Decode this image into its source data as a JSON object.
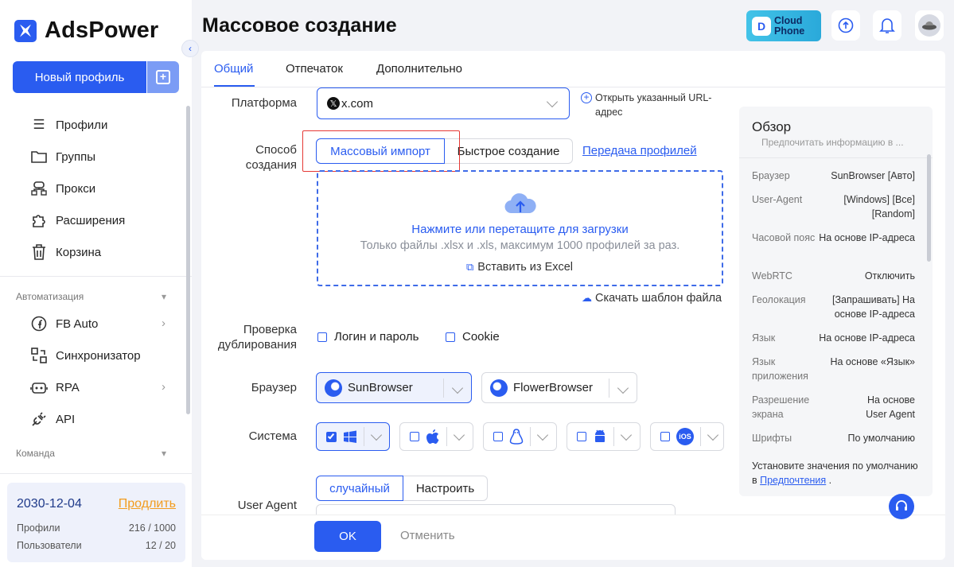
{
  "app": {
    "name": "AdsPower"
  },
  "sidebar": {
    "new_profile": "Новый профиль",
    "nav": [
      {
        "label": "Профили",
        "icon": "list-icon"
      },
      {
        "label": "Группы",
        "icon": "folder-icon"
      },
      {
        "label": "Прокси",
        "icon": "network-icon"
      },
      {
        "label": "Расширения",
        "icon": "puzzle-icon"
      },
      {
        "label": "Корзина",
        "icon": "trash-icon"
      }
    ],
    "automation_label": "Автоматизация",
    "automation": [
      {
        "label": "FB Auto",
        "icon": "facebook-icon"
      },
      {
        "label": "Синхронизатор",
        "icon": "sync-icon"
      },
      {
        "label": "RPA",
        "icon": "robot-icon"
      },
      {
        "label": "API",
        "icon": "plug-icon"
      }
    ],
    "team_label": "Команда",
    "account": {
      "date": "2030-12-04",
      "renew": "Продлить",
      "profiles_label": "Профили",
      "profiles_value": "216 / 1000",
      "users_label": "Пользователи",
      "users_value": "12 / 20"
    }
  },
  "header": {
    "title": "Массовое создание",
    "cloudphone_line1": "Cloud",
    "cloudphone_line2": "Phone"
  },
  "tabs": [
    "Общий",
    "Отпечаток",
    "Дополнительно"
  ],
  "form": {
    "platform_label": "Платформа",
    "platform_value": "x.com",
    "open_url_line1": "Открыть указанный URL-",
    "open_url_line2": "адрес",
    "method_label_line1": "Способ",
    "method_label_line2": "создания",
    "method_import": "Массовый импорт",
    "method_quick": "Быстрое создание",
    "transfer_link": "Передача профилей",
    "upload_title": "Нажмите или перетащите для загрузки",
    "upload_hint": "Только файлы .xlsx и .xls, максимум 1000 профилей за раз.",
    "paste_excel": "Вставить из Excel",
    "download_template": "Скачать шаблон файла",
    "dup_label_line1": "Проверка",
    "dup_label_line2": "дублирования",
    "dup_login": "Логин и пароль",
    "dup_cookie": "Cookie",
    "browser_label": "Браузер",
    "browser_sun": "SunBrowser",
    "browser_flower": "FlowerBrowser",
    "system_label": "Система",
    "system_ios": "iOS",
    "ua_label": "User Agent",
    "ua_random": "случайный",
    "ua_custom": "Настроить",
    "ok": "OK",
    "cancel": "Отменить"
  },
  "overview": {
    "title": "Обзор",
    "subtitle": "Предпочитать информацию в ...",
    "rows": [
      {
        "key": "Браузер",
        "val": "SunBrowser [Авто]"
      },
      {
        "key": "User-Agent",
        "val": "[Windows] [Все] [Random]"
      },
      {
        "key": "Часовой пояс",
        "val": "На основе IP-адреса"
      },
      {
        "key": "WebRTC",
        "val": "Отключить"
      },
      {
        "key": "Геолокация",
        "val": "[Запрашивать] На основе IP-адреса"
      },
      {
        "key": "Язык",
        "val": "На основе IP-адреса"
      },
      {
        "key": "Язык приложения",
        "val": "На основе «Язык»"
      },
      {
        "key": "Разрешение экрана",
        "val": "На основе User Agent"
      },
      {
        "key": "Шрифты",
        "val": "По умолчанию"
      }
    ],
    "foot_text": "Установите значения по умолчанию в",
    "foot_link": "Предпочтения",
    "foot_end": "."
  },
  "colors": {
    "accent": "#2a5cf0",
    "warning": "#f29c1f",
    "highlight": "#e53935"
  }
}
